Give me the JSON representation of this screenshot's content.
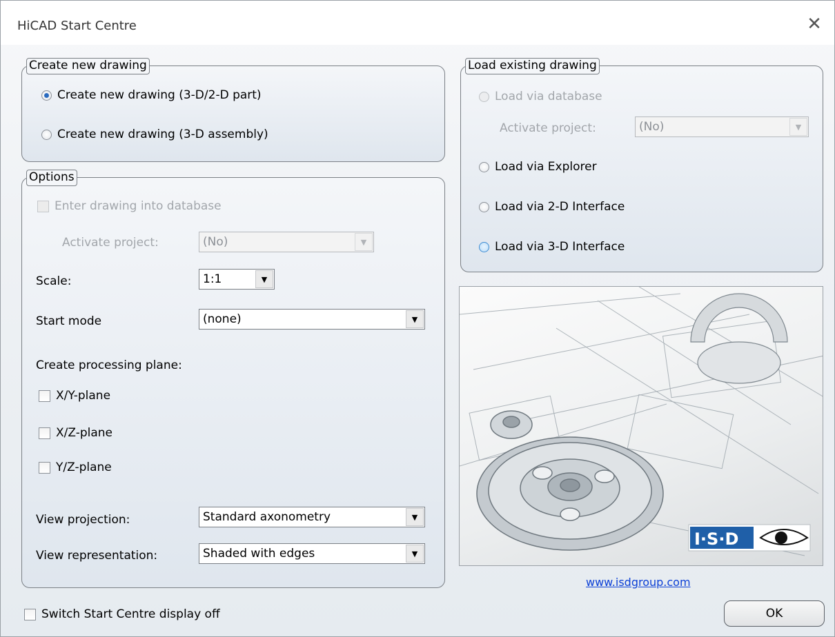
{
  "window": {
    "title": "HiCAD Start Centre",
    "close_glyph": "✕"
  },
  "create_group": {
    "legend": "Create new drawing",
    "options": [
      {
        "label": "Create new drawing (3-D/2-D part)",
        "checked": true
      },
      {
        "label": "Create new drawing (3-D assembly)",
        "checked": false
      }
    ]
  },
  "options_group": {
    "legend": "Options",
    "enter_db_label": "Enter drawing into database",
    "activate_project_label": "Activate project:",
    "activate_project_value": "(No)",
    "scale_label": "Scale:",
    "scale_value": "1:1",
    "start_mode_label": "Start mode",
    "start_mode_value": "(none)",
    "plane_heading": "Create processing plane:",
    "planes": [
      "X/Y-plane",
      "X/Z-plane",
      "Y/Z-plane"
    ],
    "view_projection_label": "View projection:",
    "view_projection_value": "Standard axonometry",
    "view_representation_label": "View representation:",
    "view_representation_value": "Shaded with edges"
  },
  "load_group": {
    "legend": "Load existing drawing",
    "via_database": "Load via database",
    "activate_project_label": "Activate project:",
    "activate_project_value": "(No)",
    "via_explorer": "Load via Explorer",
    "via_2d": "Load via 2-D Interface",
    "via_3d": "Load via 3-D Interface"
  },
  "preview": {
    "logo_text": "I·S·D"
  },
  "link": "www.isdgroup.com",
  "footer": {
    "switch_off_label": "Switch Start Centre display off",
    "ok_label": "OK"
  },
  "colors": {
    "link": "#0b3fd6",
    "radio_selected": "#2b6bbf",
    "logo_blue": "#1f5fa8"
  }
}
